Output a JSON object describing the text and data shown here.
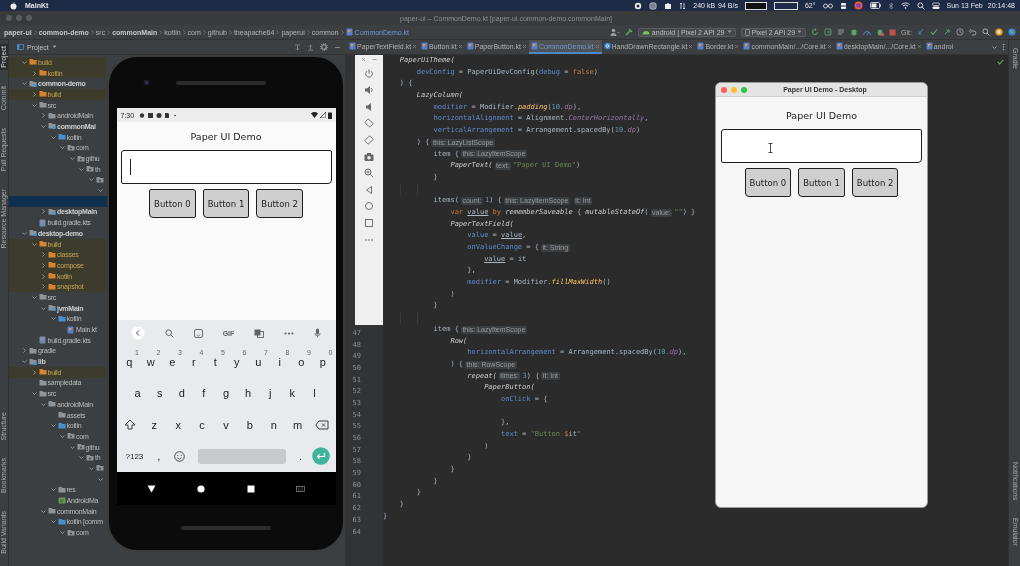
{
  "menu_bar": {
    "app_name": "MainKt",
    "network_up": "240 kB",
    "network_down": "94 B/s",
    "temperature": "62°",
    "date": "Sun 13 Feb",
    "time": "20:14:48"
  },
  "window": {
    "title": "paper-ui – CommonDemo.kt [paper-ui.common-demo.commonMain]"
  },
  "breadcrumbs": [
    {
      "label": "paper-ui",
      "kind": "module"
    },
    {
      "label": "common-demo",
      "kind": "module"
    },
    {
      "label": "src",
      "kind": "folder"
    },
    {
      "label": "commonMain",
      "kind": "module"
    },
    {
      "label": "kotlin",
      "kind": "folder"
    },
    {
      "label": "com",
      "kind": "folder"
    },
    {
      "label": "github",
      "kind": "folder"
    },
    {
      "label": "theapache64",
      "kind": "folder"
    },
    {
      "label": "paperui",
      "kind": "folder"
    },
    {
      "label": "common",
      "kind": "folder"
    },
    {
      "label": "CommonDemo.kt",
      "kind": "file"
    }
  ],
  "toolbar": {
    "run_configuration": "android | Pixel 2 API 29",
    "device": "Pixel 2 API 29",
    "vcs_label": "Git:"
  },
  "left_tool_strip": {
    "top": [
      {
        "label": "Project",
        "selected": true
      },
      {
        "label": "Commit",
        "selected": false
      },
      {
        "label": "Pull Requests",
        "selected": false
      },
      {
        "label": "Resource Manager",
        "selected": false
      }
    ],
    "bottom": [
      {
        "label": "Structure",
        "selected": false
      },
      {
        "label": "Bookmarks",
        "selected": false
      },
      {
        "label": "Build Variants",
        "selected": false
      }
    ]
  },
  "project_panel": {
    "title": "Project",
    "tree": [
      {
        "label": "build",
        "kind": "excluded",
        "expanded": true,
        "selected": false,
        "children": [
          {
            "label": "kotlin",
            "kind": "excluded",
            "expanded": false,
            "selected": false
          }
        ]
      },
      {
        "label": "common-demo",
        "kind": "module",
        "expanded": true,
        "selected": false,
        "children": [
          {
            "label": "build",
            "kind": "excluded",
            "expanded": false,
            "selected": false
          },
          {
            "label": "src",
            "kind": "folder",
            "expanded": true,
            "selected": false,
            "children": [
              {
                "label": "androidMain",
                "kind": "folder",
                "expanded": false,
                "selected": false
              },
              {
                "label": "commonMai",
                "kind": "source-set",
                "expanded": true,
                "selected": false,
                "children": [
                  {
                    "label": "kotlin",
                    "kind": "source-root",
                    "expanded": true,
                    "selected": false,
                    "children": [
                      {
                        "label": "com",
                        "kind": "package",
                        "expanded": true,
                        "selected": false,
                        "children": [
                          {
                            "label": "githu",
                            "kind": "package",
                            "expanded": true,
                            "selected": false,
                            "children": [
                              {
                                "label": "th",
                                "kind": "package",
                                "expanded": true,
                                "selected": false,
                                "children": [
                                  {
                                    "kind": "package",
                                    "expanded": true,
                                    "selected": false,
                                    "children": [
                                      {
                                        "expanded": true,
                                        "selected": false,
                                        "children": [
                                          {
                                            "selected": true
                                          }
                                        ]
                                      }
                                    ]
                                  }
                                ]
                              }
                            ]
                          }
                        ]
                      }
                    ]
                  }
                ]
              },
              {
                "label": "desktopMain",
                "kind": "source-set",
                "expanded": false,
                "selected": false
              }
            ]
          },
          {
            "label": "build.gradle.kts",
            "kind": "gradle-file",
            "selected": false
          }
        ]
      },
      {
        "label": "desktop-demo",
        "kind": "module",
        "expanded": true,
        "selected": false,
        "children": [
          {
            "label": "build",
            "kind": "excluded",
            "expanded": true,
            "selected": false,
            "children": [
              {
                "label": "classes",
                "kind": "excluded",
                "expanded": false,
                "selected": false
              },
              {
                "label": "compose",
                "kind": "excluded",
                "expanded": false,
                "selected": false
              },
              {
                "label": "kotlin",
                "kind": "excluded",
                "expanded": false,
                "selected": false
              },
              {
                "label": "snapshot",
                "kind": "excluded",
                "expanded": false,
                "selected": false
              }
            ]
          },
          {
            "label": "src",
            "kind": "folder",
            "expanded": true,
            "selected": false,
            "children": [
              {
                "label": "jvmMain",
                "kind": "source-set",
                "expanded": true,
                "selected": false,
                "children": [
                  {
                    "label": "kotlin",
                    "kind": "source-root",
                    "expanded": true,
                    "selected": false,
                    "children": [
                      {
                        "label": "Main.kt",
                        "kind": "kotlin-file",
                        "selected": false
                      }
                    ]
                  }
                ]
              }
            ]
          },
          {
            "label": "build.gradle.kts",
            "kind": "gradle-file",
            "selected": false
          }
        ]
      },
      {
        "label": "gradle",
        "kind": "folder",
        "expanded": false,
        "selected": false
      },
      {
        "label": "lib",
        "kind": "module",
        "expanded": true,
        "selected": false,
        "children": [
          {
            "label": "build",
            "kind": "excluded",
            "expanded": false,
            "selected": false
          },
          {
            "label": "sampledata",
            "kind": "folder",
            "selected": false
          },
          {
            "label": "src",
            "kind": "folder",
            "expanded": true,
            "selected": false,
            "children": [
              {
                "label": "androidMain",
                "kind": "folder",
                "expanded": true,
                "selected": false,
                "children": [
                  {
                    "label": "assets",
                    "kind": "folder",
                    "selected": false
                  },
                  {
                    "label": "kotlin",
                    "kind": "source-root",
                    "expanded": true,
                    "selected": false,
                    "children": [
                      {
                        "label": "com",
                        "kind": "package",
                        "expanded": true,
                        "selected": false,
                        "children": [
                          {
                            "label": "githu",
                            "kind": "package",
                            "expanded": true,
                            "selected": false,
                            "children": [
                              {
                                "label": "th",
                                "kind": "package",
                                "expanded": true,
                                "selected": false,
                                "children": [
                                  {
                                    "kind": "package",
                                    "expanded": true,
                                    "selected": false,
                                    "children": [
                                      {
                                        "expanded": true,
                                        "selected": false
                                      }
                                    ]
                                  }
                                ]
                              }
                            ]
                          }
                        ]
                      }
                    ]
                  },
                  {
                    "label": "res",
                    "kind": "folder",
                    "expanded": true,
                    "selected": false
                  },
                  {
                    "label": "AndroidMa",
                    "kind": "manifest-file",
                    "selected": false
                  }
                ]
              },
              {
                "label": "commonMain",
                "kind": "folder",
                "expanded": true,
                "selected": false,
                "children": [
                  {
                    "label": "kotlin [comm",
                    "kind": "source-root",
                    "expanded": true,
                    "selected": false,
                    "children": [
                      {
                        "label": "com",
                        "kind": "package",
                        "expanded": true,
                        "selected": false
                      }
                    ]
                  }
                ]
              }
            ]
          }
        ]
      }
    ]
  },
  "editor": {
    "tabs": [
      {
        "label": "PaperTextField.kt",
        "kind": "kotlin-file",
        "selected": false,
        "closable": true
      },
      {
        "label": "Button.kt",
        "kind": "kotlin-file",
        "selected": false,
        "closable": true
      },
      {
        "label": "PaperButton.kt",
        "kind": "kotlin-file",
        "selected": false,
        "closable": true
      },
      {
        "label": "CommonDemo.kt",
        "kind": "kotlin-file",
        "selected": true,
        "closable": true
      },
      {
        "label": "HandDrawnRectangle.kt",
        "kind": "kotlin-class",
        "selected": false,
        "closable": true
      },
      {
        "label": "Border.kt",
        "kind": "kotlin-file",
        "selected": false,
        "closable": true
      },
      {
        "label": "commonMain/.../Core.kt",
        "kind": "kotlin-file",
        "selected": false,
        "closable": true
      },
      {
        "label": "desktopMain/.../Core.kt",
        "kind": "kotlin-file",
        "selected": false,
        "closable": true
      },
      {
        "label": "androi",
        "kind": "kotlin-file",
        "selected": false,
        "closable": false
      }
    ],
    "lines": [
      {
        "tokens": [
          {
            "kind": "fn",
            "text": "    PaperUiTheme("
          }
        ]
      },
      {
        "tokens": [
          {
            "kind": "param",
            "text": "        devConfig"
          },
          {
            "kind": "plain",
            "text": " = PaperUiDevConfig("
          },
          {
            "kind": "param",
            "text": "debug"
          },
          {
            "kind": "plain",
            "text": " = "
          },
          {
            "kind": "kw",
            "text": "false"
          },
          {
            "kind": "plain",
            "text": ")"
          }
        ]
      },
      {
        "tokens": [
          {
            "kind": "plain",
            "text": "    ) {"
          }
        ]
      },
      {
        "tokens": [
          {
            "kind": "fn",
            "text": "        LazyColumn("
          }
        ]
      },
      {
        "tokens": [
          {
            "kind": "param",
            "text": "            modifier"
          },
          {
            "kind": "plain",
            "text": " = Modifier."
          },
          {
            "kind": "ext",
            "text": "padding"
          },
          {
            "kind": "plain",
            "text": "("
          },
          {
            "kind": "num",
            "text": "10"
          },
          {
            "kind": "prop",
            "text": ".dp"
          },
          {
            "kind": "plain",
            "text": "),"
          }
        ]
      },
      {
        "tokens": [
          {
            "kind": "param",
            "text": "            horizontalAlignment"
          },
          {
            "kind": "plain",
            "text": " = Alignment."
          },
          {
            "kind": "prop",
            "text": "CenterHorizontally"
          },
          {
            "kind": "plain",
            "text": ","
          }
        ]
      },
      {
        "tokens": [
          {
            "kind": "param",
            "text": "            verticalArrangement"
          },
          {
            "kind": "plain",
            "text": " = Arrangement.spacedBy("
          },
          {
            "kind": "num",
            "text": "10"
          },
          {
            "kind": "prop",
            "text": ".dp"
          },
          {
            "kind": "plain",
            "text": ")"
          }
        ]
      },
      {
        "tokens": [
          {
            "kind": "plain",
            "text": "        ) {"
          },
          {
            "kind": "hint",
            "text": "this: LazyListScope"
          }
        ]
      },
      {
        "tokens": [
          {
            "kind": "plain",
            "text": "            item {"
          },
          {
            "kind": "hint",
            "text": "this: LazyItemScope"
          }
        ]
      },
      {
        "tokens": [
          {
            "kind": "fn",
            "text": "                PaperText("
          },
          {
            "kind": "hint",
            "text": "text:"
          },
          {
            "kind": "str",
            "text": "\"Paper UI Demo\""
          },
          {
            "kind": "plain",
            "text": ")"
          }
        ]
      },
      {
        "tokens": [
          {
            "kind": "plain",
            "text": "            }"
          }
        ]
      },
      {
        "kind": "blank"
      },
      {
        "tokens": [
          {
            "kind": "plain",
            "text": "            items("
          },
          {
            "kind": "hint",
            "text": "count:"
          },
          {
            "kind": "num",
            "text": "1"
          },
          {
            "kind": "plain",
            "text": ") {"
          },
          {
            "kind": "hint",
            "text": "this: LazyItemScope"
          },
          {
            "kind": "hint",
            "text": "it: Int"
          }
        ]
      },
      {
        "tokens": [
          {
            "kind": "kw",
            "text": "                var "
          },
          {
            "kind": "var",
            "text": "value"
          },
          {
            "kind": "kw",
            "text": " by "
          },
          {
            "kind": "fn",
            "text": "rememberSaveable"
          },
          {
            "kind": "plain",
            "text": " { "
          },
          {
            "kind": "fn",
            "text": "mutableStateOf"
          },
          {
            "kind": "plain",
            "text": "("
          },
          {
            "kind": "hint",
            "text": "value:"
          },
          {
            "kind": "str",
            "text": "\"\""
          },
          {
            "kind": "plain",
            "text": ") }"
          }
        ]
      },
      {
        "tokens": [
          {
            "kind": "fn",
            "text": "                PaperTextField("
          }
        ]
      },
      {
        "tokens": [
          {
            "kind": "param",
            "text": "                    value"
          },
          {
            "kind": "plain",
            "text": " = "
          },
          {
            "kind": "var",
            "text": "value"
          },
          {
            "kind": "plain",
            "text": ","
          }
        ]
      },
      {
        "tokens": [
          {
            "kind": "param",
            "text": "                    onValueChange"
          },
          {
            "kind": "plain",
            "text": " = {"
          },
          {
            "kind": "hint",
            "text": "it: String"
          }
        ]
      },
      {
        "tokens": [
          {
            "kind": "var",
            "text": "                        value"
          },
          {
            "kind": "plain",
            "text": " = it"
          }
        ]
      },
      {
        "tokens": [
          {
            "kind": "plain",
            "text": "                    },"
          }
        ]
      },
      {
        "tokens": [
          {
            "kind": "param",
            "text": "                    modifier"
          },
          {
            "kind": "plain",
            "text": " = Modifier."
          },
          {
            "kind": "ext",
            "text": "fillMaxWidth"
          },
          {
            "kind": "plain",
            "text": "()"
          }
        ]
      },
      {
        "tokens": [
          {
            "kind": "plain",
            "text": "                )"
          }
        ]
      },
      {
        "tokens": [
          {
            "kind": "plain",
            "text": "            }"
          }
        ]
      },
      {
        "kind": "blank"
      },
      {
        "number": "47",
        "tokens": [
          {
            "kind": "plain",
            "text": "            item {"
          },
          {
            "kind": "hint",
            "text": "this: LazyItemScope"
          }
        ]
      },
      {
        "number": "48",
        "tokens": [
          {
            "kind": "fn",
            "text": "                Row("
          }
        ]
      },
      {
        "number": "49",
        "tokens": [
          {
            "kind": "param",
            "text": "                    horizontalArrangement"
          },
          {
            "kind": "plain",
            "text": " = Arrangement.spacedBy("
          },
          {
            "kind": "num",
            "text": "10"
          },
          {
            "kind": "prop",
            "text": ".dp"
          },
          {
            "kind": "plain",
            "text": "),"
          }
        ]
      },
      {
        "number": "50",
        "tokens": [
          {
            "kind": "plain",
            "text": "                ) {"
          },
          {
            "kind": "hint",
            "text": "this: RowScope"
          }
        ]
      },
      {
        "number": "51",
        "tokens": [
          {
            "kind": "fn",
            "text": "                    repeat("
          },
          {
            "kind": "hint",
            "text": "times:"
          },
          {
            "kind": "num",
            "text": "3"
          },
          {
            "kind": "plain",
            "text": ") {"
          },
          {
            "kind": "hint",
            "text": "it: Int"
          }
        ]
      },
      {
        "number": "52",
        "tokens": [
          {
            "kind": "fn",
            "text": "                        PaperButton("
          }
        ]
      },
      {
        "number": "53",
        "tokens": [
          {
            "kind": "param",
            "text": "                            onClick"
          },
          {
            "kind": "plain",
            "text": " = {"
          }
        ]
      },
      {
        "number": "54"
      },
      {
        "number": "55",
        "tokens": [
          {
            "kind": "plain",
            "text": "                            },"
          }
        ]
      },
      {
        "number": "56",
        "tokens": [
          {
            "kind": "param",
            "text": "                            text"
          },
          {
            "kind": "plain",
            "text": " = "
          },
          {
            "kind": "str",
            "text": "\"Button "
          },
          {
            "kind": "kw",
            "text": "$"
          },
          {
            "kind": "plain",
            "text": "it"
          },
          {
            "kind": "str",
            "text": "\""
          }
        ]
      },
      {
        "number": "57",
        "tokens": [
          {
            "kind": "plain",
            "text": "                        )"
          }
        ]
      },
      {
        "number": "58",
        "tokens": [
          {
            "kind": "plain",
            "text": "                    }"
          }
        ]
      },
      {
        "number": "59",
        "tokens": [
          {
            "kind": "plain",
            "text": "                }"
          }
        ]
      },
      {
        "number": "60",
        "tokens": [
          {
            "kind": "plain",
            "text": "            }"
          }
        ]
      },
      {
        "number": "61",
        "tokens": [
          {
            "kind": "plain",
            "text": "        }"
          }
        ]
      },
      {
        "number": "62",
        "tokens": [
          {
            "kind": "plain",
            "text": "    }"
          }
        ]
      },
      {
        "number": "63",
        "tokens": [
          {
            "kind": "plain",
            "text": "}"
          }
        ]
      },
      {
        "number": "64"
      }
    ]
  },
  "right_tool_strip": {
    "top": [
      {
        "label": "Gradle"
      }
    ],
    "bottom": [
      {
        "label": "Notifications"
      },
      {
        "label": "Emulator"
      }
    ]
  },
  "phone": {
    "status_time": "7:30",
    "app": {
      "title": "Paper UI Demo",
      "field": {
        "focused": true
      },
      "buttons": [
        "Button 0",
        "Button 1",
        "Button 2"
      ]
    },
    "keyboard": {
      "toolbar": [
        {
          "kind": "back"
        },
        {
          "kind": "search"
        },
        {
          "kind": "sticker"
        },
        {
          "kind": "label",
          "label": "GIF"
        },
        {
          "kind": "translate"
        },
        {
          "kind": "more"
        },
        {
          "kind": "mic"
        }
      ],
      "rows": [
        [
          {
            "kind": "char",
            "label": "q",
            "hint": "1"
          },
          {
            "kind": "char",
            "label": "w",
            "hint": "2"
          },
          {
            "kind": "char",
            "label": "e",
            "hint": "3"
          },
          {
            "kind": "char",
            "label": "r",
            "hint": "4"
          },
          {
            "kind": "char",
            "label": "t",
            "hint": "5"
          },
          {
            "kind": "char",
            "label": "y",
            "hint": "6"
          },
          {
            "kind": "char",
            "label": "u",
            "hint": "7"
          },
          {
            "kind": "char",
            "label": "i",
            "hint": "8"
          },
          {
            "kind": "char",
            "label": "o",
            "hint": "9"
          },
          {
            "kind": "char",
            "label": "p",
            "hint": "0"
          }
        ],
        [
          {
            "kind": "char",
            "label": "a"
          },
          {
            "kind": "char",
            "label": "s"
          },
          {
            "kind": "char",
            "label": "d"
          },
          {
            "kind": "char",
            "label": "f"
          },
          {
            "kind": "char",
            "label": "g"
          },
          {
            "kind": "char",
            "label": "h"
          },
          {
            "kind": "char",
            "label": "j"
          },
          {
            "kind": "char",
            "label": "k"
          },
          {
            "kind": "char",
            "label": "l"
          }
        ],
        [
          {
            "kind": "shift"
          },
          {
            "kind": "char",
            "label": "z"
          },
          {
            "kind": "char",
            "label": "x"
          },
          {
            "kind": "char",
            "label": "c"
          },
          {
            "kind": "char",
            "label": "v"
          },
          {
            "kind": "char",
            "label": "b"
          },
          {
            "kind": "char",
            "label": "n"
          },
          {
            "kind": "char",
            "label": "m"
          },
          {
            "kind": "backspace"
          }
        ],
        [
          {
            "kind": "char",
            "label": "?123"
          },
          {
            "kind": "char",
            "label": ","
          },
          {
            "kind": "emoji"
          },
          {
            "kind": "space"
          },
          {
            "kind": "char",
            "label": "."
          },
          {
            "kind": "enter"
          }
        ]
      ]
    }
  },
  "desktop_window": {
    "title": "Paper UI Demo - Desktop",
    "app": {
      "title": "Paper UI Demo",
      "field": {
        "focused": false
      },
      "buttons": [
        "Button 0",
        "Button 1",
        "Button 2"
      ]
    }
  }
}
